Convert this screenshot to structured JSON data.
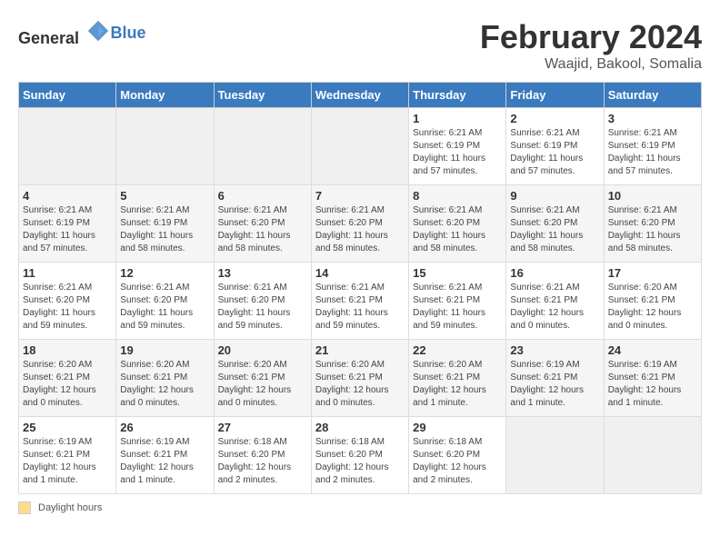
{
  "header": {
    "logo_general": "General",
    "logo_blue": "Blue",
    "title": "February 2024",
    "subtitle": "Waajid, Bakool, Somalia"
  },
  "columns": [
    "Sunday",
    "Monday",
    "Tuesday",
    "Wednesday",
    "Thursday",
    "Friday",
    "Saturday"
  ],
  "weeks": [
    [
      {
        "day": "",
        "detail": ""
      },
      {
        "day": "",
        "detail": ""
      },
      {
        "day": "",
        "detail": ""
      },
      {
        "day": "",
        "detail": ""
      },
      {
        "day": "1",
        "detail": "Sunrise: 6:21 AM\nSunset: 6:19 PM\nDaylight: 11 hours\nand 57 minutes."
      },
      {
        "day": "2",
        "detail": "Sunrise: 6:21 AM\nSunset: 6:19 PM\nDaylight: 11 hours\nand 57 minutes."
      },
      {
        "day": "3",
        "detail": "Sunrise: 6:21 AM\nSunset: 6:19 PM\nDaylight: 11 hours\nand 57 minutes."
      }
    ],
    [
      {
        "day": "4",
        "detail": "Sunrise: 6:21 AM\nSunset: 6:19 PM\nDaylight: 11 hours\nand 57 minutes."
      },
      {
        "day": "5",
        "detail": "Sunrise: 6:21 AM\nSunset: 6:19 PM\nDaylight: 11 hours\nand 58 minutes."
      },
      {
        "day": "6",
        "detail": "Sunrise: 6:21 AM\nSunset: 6:20 PM\nDaylight: 11 hours\nand 58 minutes."
      },
      {
        "day": "7",
        "detail": "Sunrise: 6:21 AM\nSunset: 6:20 PM\nDaylight: 11 hours\nand 58 minutes."
      },
      {
        "day": "8",
        "detail": "Sunrise: 6:21 AM\nSunset: 6:20 PM\nDaylight: 11 hours\nand 58 minutes."
      },
      {
        "day": "9",
        "detail": "Sunrise: 6:21 AM\nSunset: 6:20 PM\nDaylight: 11 hours\nand 58 minutes."
      },
      {
        "day": "10",
        "detail": "Sunrise: 6:21 AM\nSunset: 6:20 PM\nDaylight: 11 hours\nand 58 minutes."
      }
    ],
    [
      {
        "day": "11",
        "detail": "Sunrise: 6:21 AM\nSunset: 6:20 PM\nDaylight: 11 hours\nand 59 minutes."
      },
      {
        "day": "12",
        "detail": "Sunrise: 6:21 AM\nSunset: 6:20 PM\nDaylight: 11 hours\nand 59 minutes."
      },
      {
        "day": "13",
        "detail": "Sunrise: 6:21 AM\nSunset: 6:20 PM\nDaylight: 11 hours\nand 59 minutes."
      },
      {
        "day": "14",
        "detail": "Sunrise: 6:21 AM\nSunset: 6:21 PM\nDaylight: 11 hours\nand 59 minutes."
      },
      {
        "day": "15",
        "detail": "Sunrise: 6:21 AM\nSunset: 6:21 PM\nDaylight: 11 hours\nand 59 minutes."
      },
      {
        "day": "16",
        "detail": "Sunrise: 6:21 AM\nSunset: 6:21 PM\nDaylight: 12 hours\nand 0 minutes."
      },
      {
        "day": "17",
        "detail": "Sunrise: 6:20 AM\nSunset: 6:21 PM\nDaylight: 12 hours\nand 0 minutes."
      }
    ],
    [
      {
        "day": "18",
        "detail": "Sunrise: 6:20 AM\nSunset: 6:21 PM\nDaylight: 12 hours\nand 0 minutes."
      },
      {
        "day": "19",
        "detail": "Sunrise: 6:20 AM\nSunset: 6:21 PM\nDaylight: 12 hours\nand 0 minutes."
      },
      {
        "day": "20",
        "detail": "Sunrise: 6:20 AM\nSunset: 6:21 PM\nDaylight: 12 hours\nand 0 minutes."
      },
      {
        "day": "21",
        "detail": "Sunrise: 6:20 AM\nSunset: 6:21 PM\nDaylight: 12 hours\nand 0 minutes."
      },
      {
        "day": "22",
        "detail": "Sunrise: 6:20 AM\nSunset: 6:21 PM\nDaylight: 12 hours\nand 1 minute."
      },
      {
        "day": "23",
        "detail": "Sunrise: 6:19 AM\nSunset: 6:21 PM\nDaylight: 12 hours\nand 1 minute."
      },
      {
        "day": "24",
        "detail": "Sunrise: 6:19 AM\nSunset: 6:21 PM\nDaylight: 12 hours\nand 1 minute."
      }
    ],
    [
      {
        "day": "25",
        "detail": "Sunrise: 6:19 AM\nSunset: 6:21 PM\nDaylight: 12 hours\nand 1 minute."
      },
      {
        "day": "26",
        "detail": "Sunrise: 6:19 AM\nSunset: 6:21 PM\nDaylight: 12 hours\nand 1 minute."
      },
      {
        "day": "27",
        "detail": "Sunrise: 6:18 AM\nSunset: 6:20 PM\nDaylight: 12 hours\nand 2 minutes."
      },
      {
        "day": "28",
        "detail": "Sunrise: 6:18 AM\nSunset: 6:20 PM\nDaylight: 12 hours\nand 2 minutes."
      },
      {
        "day": "29",
        "detail": "Sunrise: 6:18 AM\nSunset: 6:20 PM\nDaylight: 12 hours\nand 2 minutes."
      },
      {
        "day": "",
        "detail": ""
      },
      {
        "day": "",
        "detail": ""
      }
    ]
  ],
  "footer": {
    "daylight_label": "Daylight hours"
  }
}
